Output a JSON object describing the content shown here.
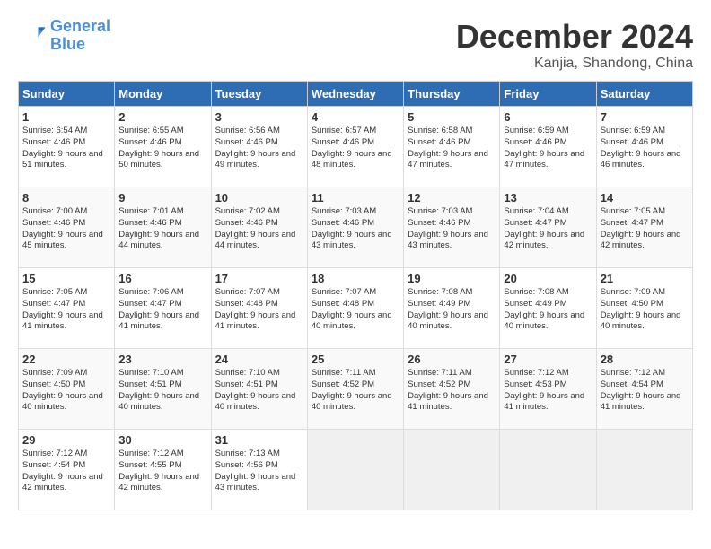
{
  "header": {
    "logo_general": "General",
    "logo_blue": "Blue",
    "month_title": "December 2024",
    "subtitle": "Kanjia, Shandong, China"
  },
  "days_of_week": [
    "Sunday",
    "Monday",
    "Tuesday",
    "Wednesday",
    "Thursday",
    "Friday",
    "Saturday"
  ],
  "weeks": [
    [
      {
        "num": "1",
        "sunrise": "6:54 AM",
        "sunset": "4:46 PM",
        "daylight": "9 hours and 51 minutes."
      },
      {
        "num": "2",
        "sunrise": "6:55 AM",
        "sunset": "4:46 PM",
        "daylight": "9 hours and 50 minutes."
      },
      {
        "num": "3",
        "sunrise": "6:56 AM",
        "sunset": "4:46 PM",
        "daylight": "9 hours and 49 minutes."
      },
      {
        "num": "4",
        "sunrise": "6:57 AM",
        "sunset": "4:46 PM",
        "daylight": "9 hours and 48 minutes."
      },
      {
        "num": "5",
        "sunrise": "6:58 AM",
        "sunset": "4:46 PM",
        "daylight": "9 hours and 47 minutes."
      },
      {
        "num": "6",
        "sunrise": "6:59 AM",
        "sunset": "4:46 PM",
        "daylight": "9 hours and 47 minutes."
      },
      {
        "num": "7",
        "sunrise": "6:59 AM",
        "sunset": "4:46 PM",
        "daylight": "9 hours and 46 minutes."
      }
    ],
    [
      {
        "num": "8",
        "sunrise": "7:00 AM",
        "sunset": "4:46 PM",
        "daylight": "9 hours and 45 minutes."
      },
      {
        "num": "9",
        "sunrise": "7:01 AM",
        "sunset": "4:46 PM",
        "daylight": "9 hours and 44 minutes."
      },
      {
        "num": "10",
        "sunrise": "7:02 AM",
        "sunset": "4:46 PM",
        "daylight": "9 hours and 44 minutes."
      },
      {
        "num": "11",
        "sunrise": "7:03 AM",
        "sunset": "4:46 PM",
        "daylight": "9 hours and 43 minutes."
      },
      {
        "num": "12",
        "sunrise": "7:03 AM",
        "sunset": "4:46 PM",
        "daylight": "9 hours and 43 minutes."
      },
      {
        "num": "13",
        "sunrise": "7:04 AM",
        "sunset": "4:47 PM",
        "daylight": "9 hours and 42 minutes."
      },
      {
        "num": "14",
        "sunrise": "7:05 AM",
        "sunset": "4:47 PM",
        "daylight": "9 hours and 42 minutes."
      }
    ],
    [
      {
        "num": "15",
        "sunrise": "7:05 AM",
        "sunset": "4:47 PM",
        "daylight": "9 hours and 41 minutes."
      },
      {
        "num": "16",
        "sunrise": "7:06 AM",
        "sunset": "4:47 PM",
        "daylight": "9 hours and 41 minutes."
      },
      {
        "num": "17",
        "sunrise": "7:07 AM",
        "sunset": "4:48 PM",
        "daylight": "9 hours and 41 minutes."
      },
      {
        "num": "18",
        "sunrise": "7:07 AM",
        "sunset": "4:48 PM",
        "daylight": "9 hours and 40 minutes."
      },
      {
        "num": "19",
        "sunrise": "7:08 AM",
        "sunset": "4:49 PM",
        "daylight": "9 hours and 40 minutes."
      },
      {
        "num": "20",
        "sunrise": "7:08 AM",
        "sunset": "4:49 PM",
        "daylight": "9 hours and 40 minutes."
      },
      {
        "num": "21",
        "sunrise": "7:09 AM",
        "sunset": "4:50 PM",
        "daylight": "9 hours and 40 minutes."
      }
    ],
    [
      {
        "num": "22",
        "sunrise": "7:09 AM",
        "sunset": "4:50 PM",
        "daylight": "9 hours and 40 minutes."
      },
      {
        "num": "23",
        "sunrise": "7:10 AM",
        "sunset": "4:51 PM",
        "daylight": "9 hours and 40 minutes."
      },
      {
        "num": "24",
        "sunrise": "7:10 AM",
        "sunset": "4:51 PM",
        "daylight": "9 hours and 40 minutes."
      },
      {
        "num": "25",
        "sunrise": "7:11 AM",
        "sunset": "4:52 PM",
        "daylight": "9 hours and 40 minutes."
      },
      {
        "num": "26",
        "sunrise": "7:11 AM",
        "sunset": "4:52 PM",
        "daylight": "9 hours and 41 minutes."
      },
      {
        "num": "27",
        "sunrise": "7:12 AM",
        "sunset": "4:53 PM",
        "daylight": "9 hours and 41 minutes."
      },
      {
        "num": "28",
        "sunrise": "7:12 AM",
        "sunset": "4:54 PM",
        "daylight": "9 hours and 41 minutes."
      }
    ],
    [
      {
        "num": "29",
        "sunrise": "7:12 AM",
        "sunset": "4:54 PM",
        "daylight": "9 hours and 42 minutes."
      },
      {
        "num": "30",
        "sunrise": "7:12 AM",
        "sunset": "4:55 PM",
        "daylight": "9 hours and 42 minutes."
      },
      {
        "num": "31",
        "sunrise": "7:13 AM",
        "sunset": "4:56 PM",
        "daylight": "9 hours and 43 minutes."
      },
      null,
      null,
      null,
      null
    ]
  ]
}
